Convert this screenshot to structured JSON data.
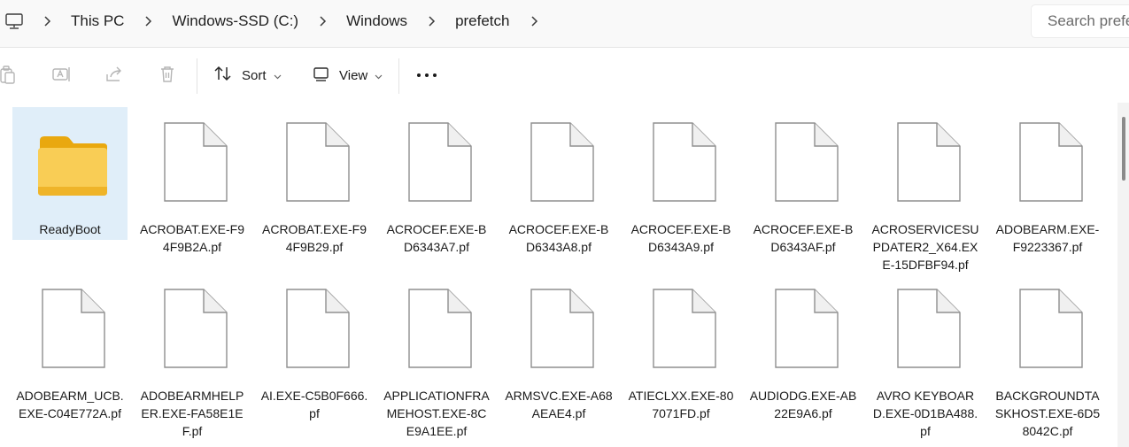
{
  "breadcrumb": {
    "items": [
      {
        "label": "This PC"
      },
      {
        "label": "Windows-SSD (C:)"
      },
      {
        "label": "Windows"
      },
      {
        "label": "prefetch"
      }
    ]
  },
  "search": {
    "placeholder": "Search prefetch"
  },
  "toolbar": {
    "sort_label": "Sort",
    "view_label": "View",
    "more_label": "•••"
  },
  "files": [
    {
      "name": "ReadyBoot",
      "type": "folder",
      "selected": true
    },
    {
      "name": "ACROBAT.EXE-F94F9B2A.pf",
      "type": "file"
    },
    {
      "name": "ACROBAT.EXE-F94F9B29.pf",
      "type": "file"
    },
    {
      "name": "ACROCEF.EXE-BD6343A7.pf",
      "type": "file"
    },
    {
      "name": "ACROCEF.EXE-BD6343A8.pf",
      "type": "file"
    },
    {
      "name": "ACROCEF.EXE-BD6343A9.pf",
      "type": "file"
    },
    {
      "name": "ACROCEF.EXE-BD6343AF.pf",
      "type": "file"
    },
    {
      "name": "ACROSERVICESUPDATER2_X64.EXE-15DFBF94.pf",
      "type": "file"
    },
    {
      "name": "ADOBEARM.EXE-F9223367.pf",
      "type": "file"
    },
    {
      "name": "ADOBEARM_UCB.EXE-C04E772A.pf",
      "type": "file"
    },
    {
      "name": "ADOBEARMHELPER.EXE-FA58E1EF.pf",
      "type": "file"
    },
    {
      "name": "AI.EXE-C5B0F666.pf",
      "type": "file"
    },
    {
      "name": "APPLICATIONFRAMEHOST.EXE-8CE9A1EE.pf",
      "type": "file"
    },
    {
      "name": "ARMSVC.EXE-A68AEAE4.pf",
      "type": "file"
    },
    {
      "name": "ATIECLXX.EXE-807071FD.pf",
      "type": "file"
    },
    {
      "name": "AUDIODG.EXE-AB22E9A6.pf",
      "type": "file"
    },
    {
      "name": "AVRO KEYBOARD.EXE-0D1BA488.pf",
      "type": "file"
    },
    {
      "name": "BACKGROUNDTASKHOST.EXE-6D58042C.pf",
      "type": "file"
    }
  ],
  "colors": {
    "selection": "#e0eef9",
    "folder": "#f7c43b",
    "accent": "#0067c0"
  }
}
